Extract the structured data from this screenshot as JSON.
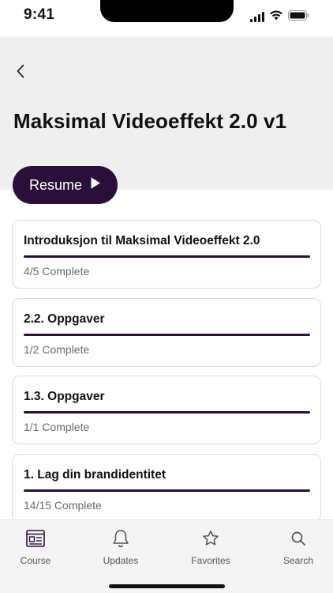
{
  "status_bar": {
    "time": "9:41",
    "icons": [
      "signal-icon",
      "wifi-icon",
      "battery-icon"
    ]
  },
  "header": {
    "back_icon": "chevron-left-icon",
    "title": "Maksimal Videoeffekt 2.0 v1",
    "resume_label": "Resume",
    "resume_icon": "play-icon"
  },
  "lessons": [
    {
      "title": "Introduksjon til Maksimal Videoeffekt 2.0",
      "status": "4/5 Complete",
      "progress": 1.0
    },
    {
      "title": "2.2. Oppgaver",
      "status": "1/2 Complete",
      "progress": 1.0
    },
    {
      "title": "1.3. Oppgaver",
      "status": "1/1 Complete",
      "progress": 1.0
    },
    {
      "title": "1. Lag din brandidentitet",
      "status": "14/15 Complete",
      "progress": 1.0
    }
  ],
  "tab_bar": {
    "tabs": [
      {
        "label": "Course",
        "icon": "course-icon",
        "active": true
      },
      {
        "label": "Updates",
        "icon": "bell-icon",
        "active": false
      },
      {
        "label": "Favorites",
        "icon": "star-icon",
        "active": false
      },
      {
        "label": "Search",
        "icon": "search-icon",
        "active": false
      }
    ]
  },
  "colors": {
    "accent": "#2a0f3b",
    "header_bg": "#efefef",
    "tab_bar_bg": "#f4f4f4"
  }
}
